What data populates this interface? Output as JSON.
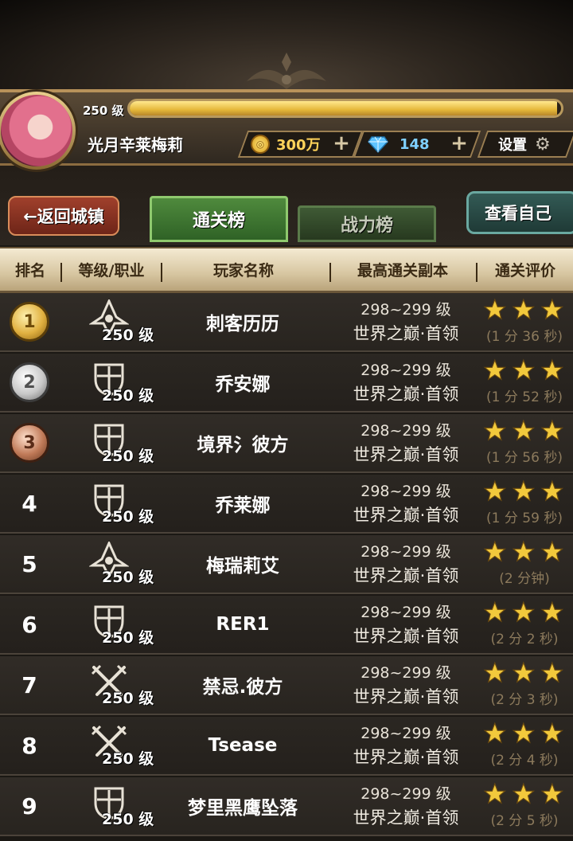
{
  "header": {
    "level": "250 级",
    "xp_fraction": 0.99,
    "player_name": "光月辛莱梅莉",
    "gold": "300万",
    "gems": "148",
    "settings_label": "设置"
  },
  "nav": {
    "back_label": "←返回城镇",
    "tab_clear": "通关榜",
    "tab_power": "战力榜",
    "view_self": "查看自己"
  },
  "columns": {
    "rank": "排名",
    "level_class": "等级/职业",
    "player": "玩家名称",
    "dungeon": "最高通关副本",
    "rating": "通关评价"
  },
  "rows": [
    {
      "rank": "1",
      "class_icon": "assassin-icon",
      "level": "250 级",
      "name": "刺客历历",
      "dungeon_level": "298~299 级",
      "dungeon": "世界之巅·首领",
      "stars": 3,
      "time": "(1 分 36 秒)"
    },
    {
      "rank": "2",
      "class_icon": "knight-shield-icon",
      "level": "250 级",
      "name": "乔安娜",
      "dungeon_level": "298~299 级",
      "dungeon": "世界之巅·首领",
      "stars": 3,
      "time": "(1 分 52 秒)"
    },
    {
      "rank": "3",
      "class_icon": "knight-shield-icon",
      "level": "250 级",
      "name": "境界氵彼方",
      "dungeon_level": "298~299 级",
      "dungeon": "世界之巅·首领",
      "stars": 3,
      "time": "(1 分 56 秒)"
    },
    {
      "rank": "4",
      "class_icon": "knight-shield-icon",
      "level": "250 级",
      "name": "乔莱娜",
      "dungeon_level": "298~299 级",
      "dungeon": "世界之巅·首领",
      "stars": 3,
      "time": "(1 分 59 秒)"
    },
    {
      "rank": "5",
      "class_icon": "assassin-icon",
      "level": "250 级",
      "name": "梅瑞莉艾",
      "dungeon_level": "298~299 级",
      "dungeon": "世界之巅·首领",
      "stars": 3,
      "time": "(2 分钟)"
    },
    {
      "rank": "6",
      "class_icon": "knight-shield-icon",
      "level": "250 级",
      "name": "RER1",
      "dungeon_level": "298~299 级",
      "dungeon": "世界之巅·首领",
      "stars": 3,
      "time": "(2 分 2 秒)"
    },
    {
      "rank": "7",
      "class_icon": "crossed-swords-icon",
      "level": "250 级",
      "name": "禁忌.彼方",
      "dungeon_level": "298~299 级",
      "dungeon": "世界之巅·首领",
      "stars": 3,
      "time": "(2 分 3 秒)"
    },
    {
      "rank": "8",
      "class_icon": "crossed-swords-icon",
      "level": "250 级",
      "name": "Tsease",
      "dungeon_level": "298~299 级",
      "dungeon": "世界之巅·首领",
      "stars": 3,
      "time": "(2 分 4 秒)"
    },
    {
      "rank": "9",
      "class_icon": "knight-shield-icon",
      "level": "250 级",
      "name": "梦里黑鹰坠落",
      "dungeon_level": "298~299 级",
      "dungeon": "世界之巅·首领",
      "stars": 3,
      "time": "(2 分 5 秒)"
    }
  ],
  "colors": {
    "star": "#f2c93c",
    "tab_active": "#4f8a3d",
    "back_button": "#a0402c",
    "time_text": "#8c7a5c"
  }
}
